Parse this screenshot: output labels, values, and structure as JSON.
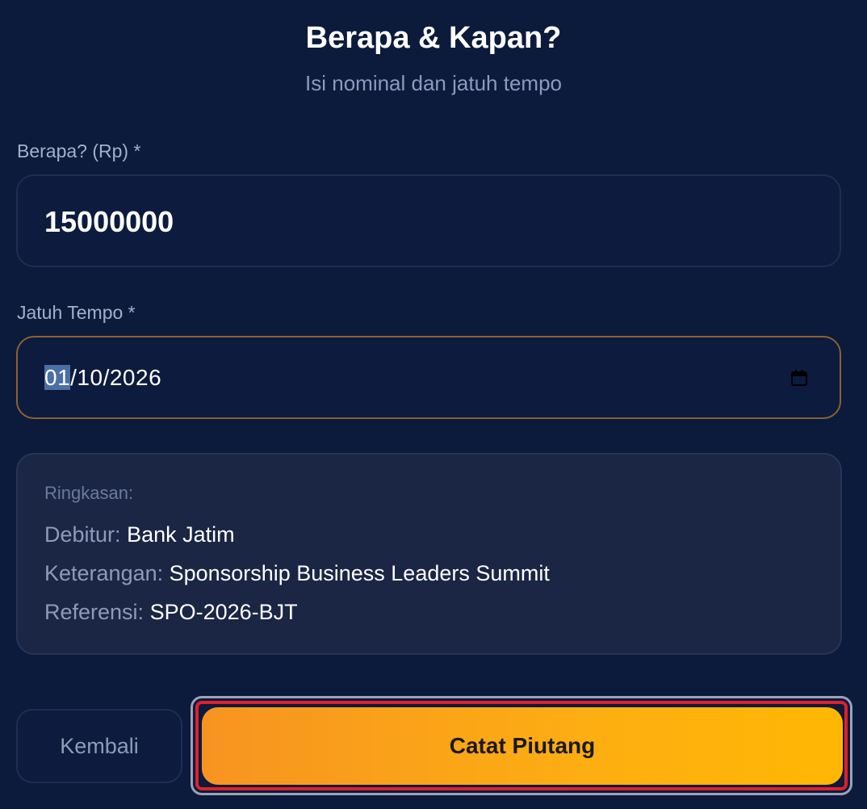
{
  "header": {
    "title": "Berapa & Kapan?",
    "subtitle": "Isi nominal dan jatuh tempo"
  },
  "form": {
    "amount": {
      "label": "Berapa? (Rp) *",
      "value": "15000000"
    },
    "due_date": {
      "label": "Jatuh Tempo *",
      "day": "01",
      "rest": "/10/2026",
      "icon": "calendar-icon"
    }
  },
  "summary": {
    "title": "Ringkasan:",
    "debtor_label": "Debitur:",
    "debtor_value": "Bank Jatim",
    "description_label": "Keterangan:",
    "description_value": "Sponsorship Business Leaders Summit",
    "reference_label": "Referensi:",
    "reference_value": "SPO-2026-BJT"
  },
  "actions": {
    "back_label": "Kembali",
    "submit_label": "Catat Piutang"
  },
  "colors": {
    "background": "#0c1a3c",
    "accent_start": "#f79421",
    "accent_end": "#ffb703",
    "focus_border": "#8a6230",
    "highlight_box": "#e0202a"
  }
}
